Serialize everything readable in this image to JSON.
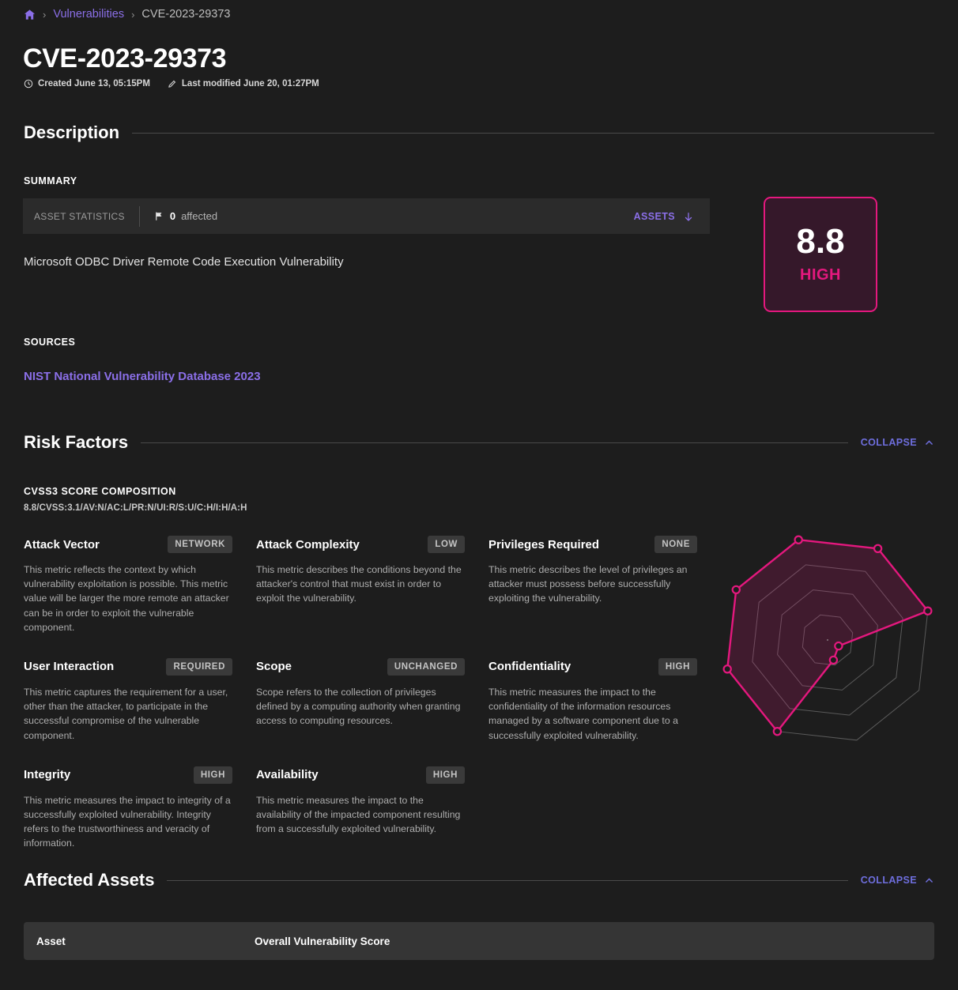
{
  "breadcrumb": {
    "home_icon": "home-icon",
    "sep": "›",
    "parent": "Vulnerabilities",
    "current": "CVE-2023-29373"
  },
  "header": {
    "title": "CVE-2023-29373",
    "created": "Created June 13, 05:15PM",
    "created_icon": "clock-icon",
    "modified": "Last modified June 20, 01:27PM",
    "modified_icon": "pencil-icon"
  },
  "description": {
    "section_title": "Description",
    "summary_label": "SUMMARY",
    "stat_label": "ASSET STATISTICS",
    "stat_icon": "flag-icon",
    "stat_count": "0",
    "stat_unit": "affected",
    "assets_link": "ASSETS",
    "assets_icon": "arrow-down-icon",
    "summary_text": "Microsoft ODBC Driver Remote Code Execution Vulnerability",
    "sources_label": "SOURCES",
    "source_link": "NIST National Vulnerability Database 2023"
  },
  "score": {
    "value": "8.8",
    "severity": "HIGH",
    "border_color": "#e4187e",
    "fill_color": "#35182a",
    "severity_color": "#e4187e"
  },
  "risk_factors": {
    "section_title": "Risk Factors",
    "collapse_label": "COLLAPSE",
    "collapse_icon": "chevron-up-icon",
    "composition_label": "CVSS3 SCORE COMPOSITION",
    "vector": "8.8/CVSS:3.1/AV:N/AC:L/PR:N/UI:R/S:U/C:H/I:H/A:H",
    "metrics": [
      {
        "name": "Attack Vector",
        "badge": "NETWORK",
        "desc": "This metric reflects the context by which vulnerability exploitation is possible. This metric value will be larger the more remote an attacker can be in order to exploit the vulnerable component."
      },
      {
        "name": "Attack Complexity",
        "badge": "LOW",
        "desc": "This metric describes the conditions beyond the attacker's control that must exist in order to exploit the vulnerability."
      },
      {
        "name": "Privileges Required",
        "badge": "NONE",
        "desc": "This metric describes the level of privileges an attacker must possess before successfully exploiting the vulnerability."
      },
      {
        "name": "User Interaction",
        "badge": "REQUIRED",
        "desc": "This metric captures the requirement for a user, other than the attacker, to participate in the successful compromise of the vulnerable component."
      },
      {
        "name": "Scope",
        "badge": "UNCHANGED",
        "desc": "Scope refers to the collection of privileges defined by a computing authority when granting access to computing resources."
      },
      {
        "name": "Confidentiality",
        "badge": "HIGH",
        "desc": "This metric measures the impact to the confidentiality of the information resources managed by a software component due to a successfully exploited vulnerability."
      },
      {
        "name": "Integrity",
        "badge": "HIGH",
        "desc": "This metric measures the impact to integrity of a successfully exploited vulnerability. Integrity refers to the trustworthiness and veracity of information."
      },
      {
        "name": "Availability",
        "badge": "HIGH",
        "desc": "This metric measures the impact to the availability of the impacted component resulting from a successfully exploited vulnerability."
      }
    ]
  },
  "chart_data": {
    "type": "radar",
    "title": "",
    "axes": [
      "Attack Vector",
      "Attack Complexity",
      "Privileges Required",
      "User Interaction",
      "Scope",
      "Confidentiality",
      "Integrity",
      "Availability"
    ],
    "labels": [
      "NETWORK",
      "LOW",
      "NONE",
      "REQUIRED",
      "UNCHANGED",
      "HIGH",
      "HIGH",
      "HIGH"
    ],
    "values": [
      1.0,
      1.0,
      1.0,
      0.12,
      0.2,
      1.0,
      1.0,
      1.0
    ],
    "max": 1.0,
    "rings": [
      0.25,
      0.5,
      0.75,
      1.0
    ],
    "grid": true,
    "legend": "none",
    "line_color": "#e4187e",
    "fill_color": "rgba(228,24,126,0.18)",
    "grid_color": "#8c8c8c"
  },
  "affected_assets": {
    "section_title": "Affected Assets",
    "collapse_label": "COLLAPSE",
    "collapse_icon": "chevron-up-icon",
    "columns": [
      "Asset",
      "Overall Vulnerability Score"
    ],
    "rows": []
  }
}
